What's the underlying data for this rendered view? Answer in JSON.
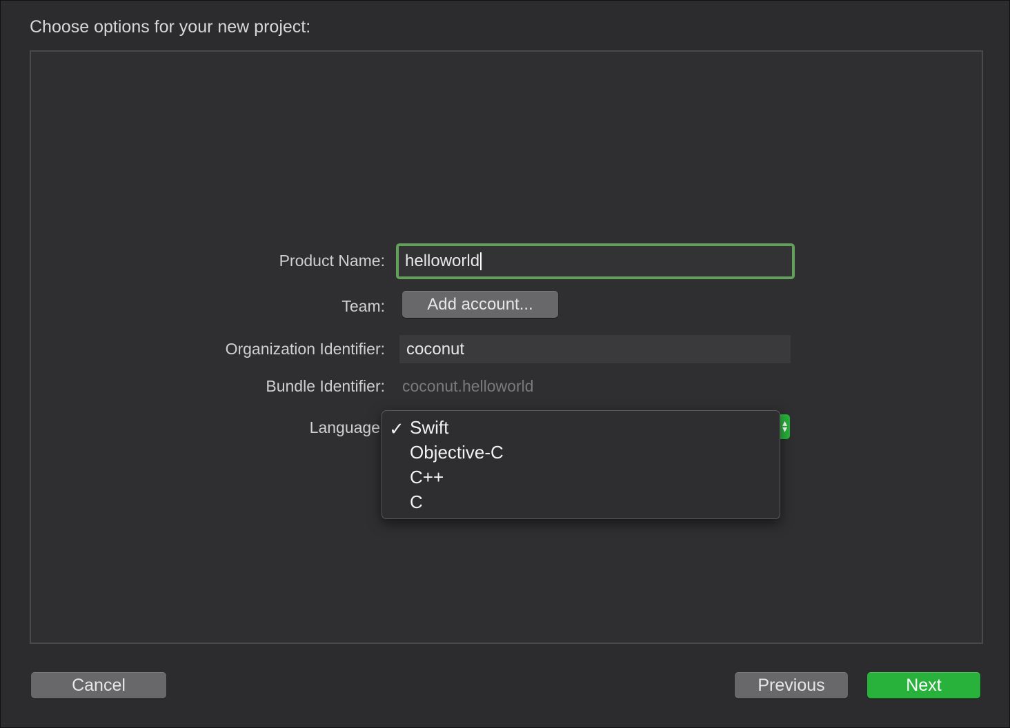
{
  "heading": "Choose options for your new project:",
  "form": {
    "product_name_label": "Product Name:",
    "product_name_value": "helloworld",
    "team_label": "Team:",
    "team_button": "Add account...",
    "org_id_label": "Organization Identifier:",
    "org_id_value": "coconut",
    "bundle_id_label": "Bundle Identifier:",
    "bundle_id_value": "coconut.helloworld",
    "language_label": "Language"
  },
  "language_menu": {
    "selected": "Swift",
    "items": [
      {
        "label": "Swift",
        "checked": true
      },
      {
        "label": "Objective-C",
        "checked": false
      },
      {
        "label": "C++",
        "checked": false
      },
      {
        "label": "C",
        "checked": false
      }
    ],
    "checkmark": "✓"
  },
  "footer": {
    "cancel": "Cancel",
    "previous": "Previous",
    "next": "Next"
  },
  "colors": {
    "accent_green": "#28b23c",
    "focus_ring": "#62a05c",
    "background": "#2c2c2e"
  }
}
